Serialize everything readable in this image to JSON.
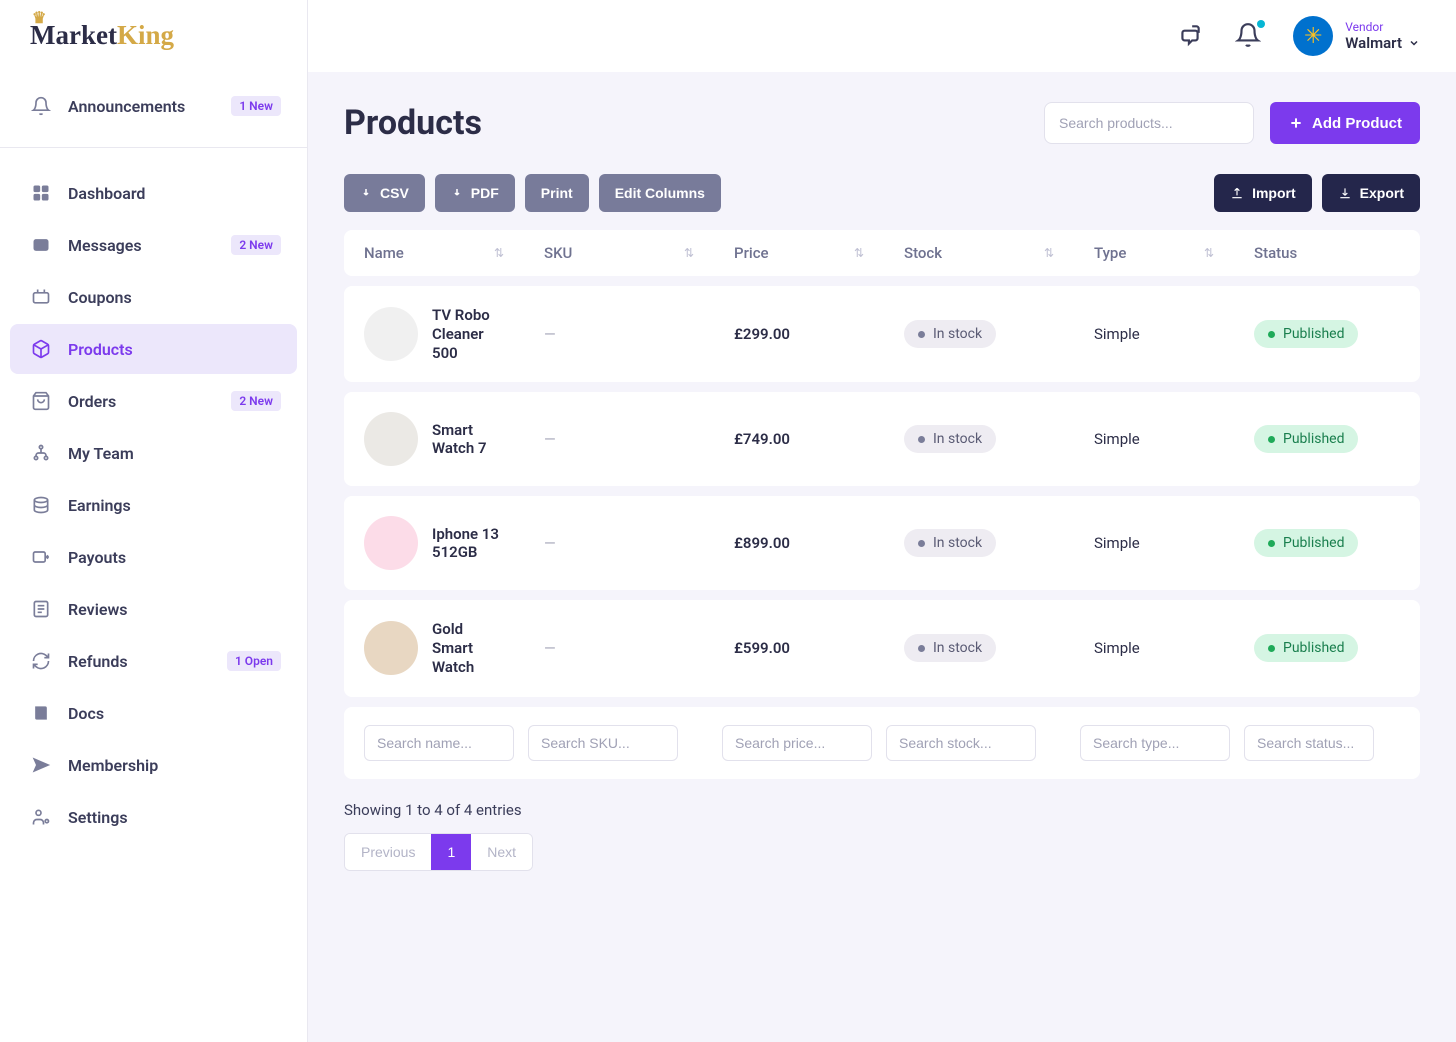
{
  "brand": {
    "name_pre": "Market",
    "name_post": "King"
  },
  "sidebar": {
    "announcements": {
      "label": "Announcements",
      "badge": "1 New"
    },
    "dashboard": {
      "label": "Dashboard"
    },
    "messages": {
      "label": "Messages",
      "badge": "2 New"
    },
    "coupons": {
      "label": "Coupons"
    },
    "products": {
      "label": "Products"
    },
    "orders": {
      "label": "Orders",
      "badge": "2 New"
    },
    "team": {
      "label": "My Team"
    },
    "earnings": {
      "label": "Earnings"
    },
    "payouts": {
      "label": "Payouts"
    },
    "reviews": {
      "label": "Reviews"
    },
    "refunds": {
      "label": "Refunds",
      "badge": "1 Open"
    },
    "docs": {
      "label": "Docs"
    },
    "membership": {
      "label": "Membership"
    },
    "settings": {
      "label": "Settings"
    }
  },
  "topbar": {
    "vendor_role": "Vendor",
    "vendor_name": "Walmart"
  },
  "page": {
    "title": "Products",
    "search_placeholder": "Search products...",
    "add_button": "Add Product"
  },
  "toolbar": {
    "csv": "CSV",
    "pdf": "PDF",
    "print": "Print",
    "edit_cols": "Edit Columns",
    "import": "Import",
    "export": "Export"
  },
  "columns": {
    "name": "Name",
    "sku": "SKU",
    "price": "Price",
    "stock": "Stock",
    "type": "Type",
    "status": "Status"
  },
  "rows": [
    {
      "name": "TV Robo Cleaner 500",
      "sku": "—",
      "price": "£299.00",
      "stock": "In stock",
      "type": "Simple",
      "status": "Published"
    },
    {
      "name": "Smart Watch 7",
      "sku": "—",
      "price": "£749.00",
      "stock": "In stock",
      "type": "Simple",
      "status": "Published"
    },
    {
      "name": "Iphone 13 512GB",
      "sku": "—",
      "price": "£899.00",
      "stock": "In stock",
      "type": "Simple",
      "status": "Published"
    },
    {
      "name": "Gold Smart Watch",
      "sku": "—",
      "price": "£599.00",
      "stock": "In stock",
      "type": "Simple",
      "status": "Published"
    }
  ],
  "filters": {
    "name": "Search name...",
    "sku": "Search SKU...",
    "price": "Search price...",
    "stock": "Search stock...",
    "type": "Search type...",
    "status": "Search status..."
  },
  "pager": {
    "info": "Showing 1 to 4 of 4 entries",
    "prev": "Previous",
    "page1": "1",
    "next": "Next"
  }
}
